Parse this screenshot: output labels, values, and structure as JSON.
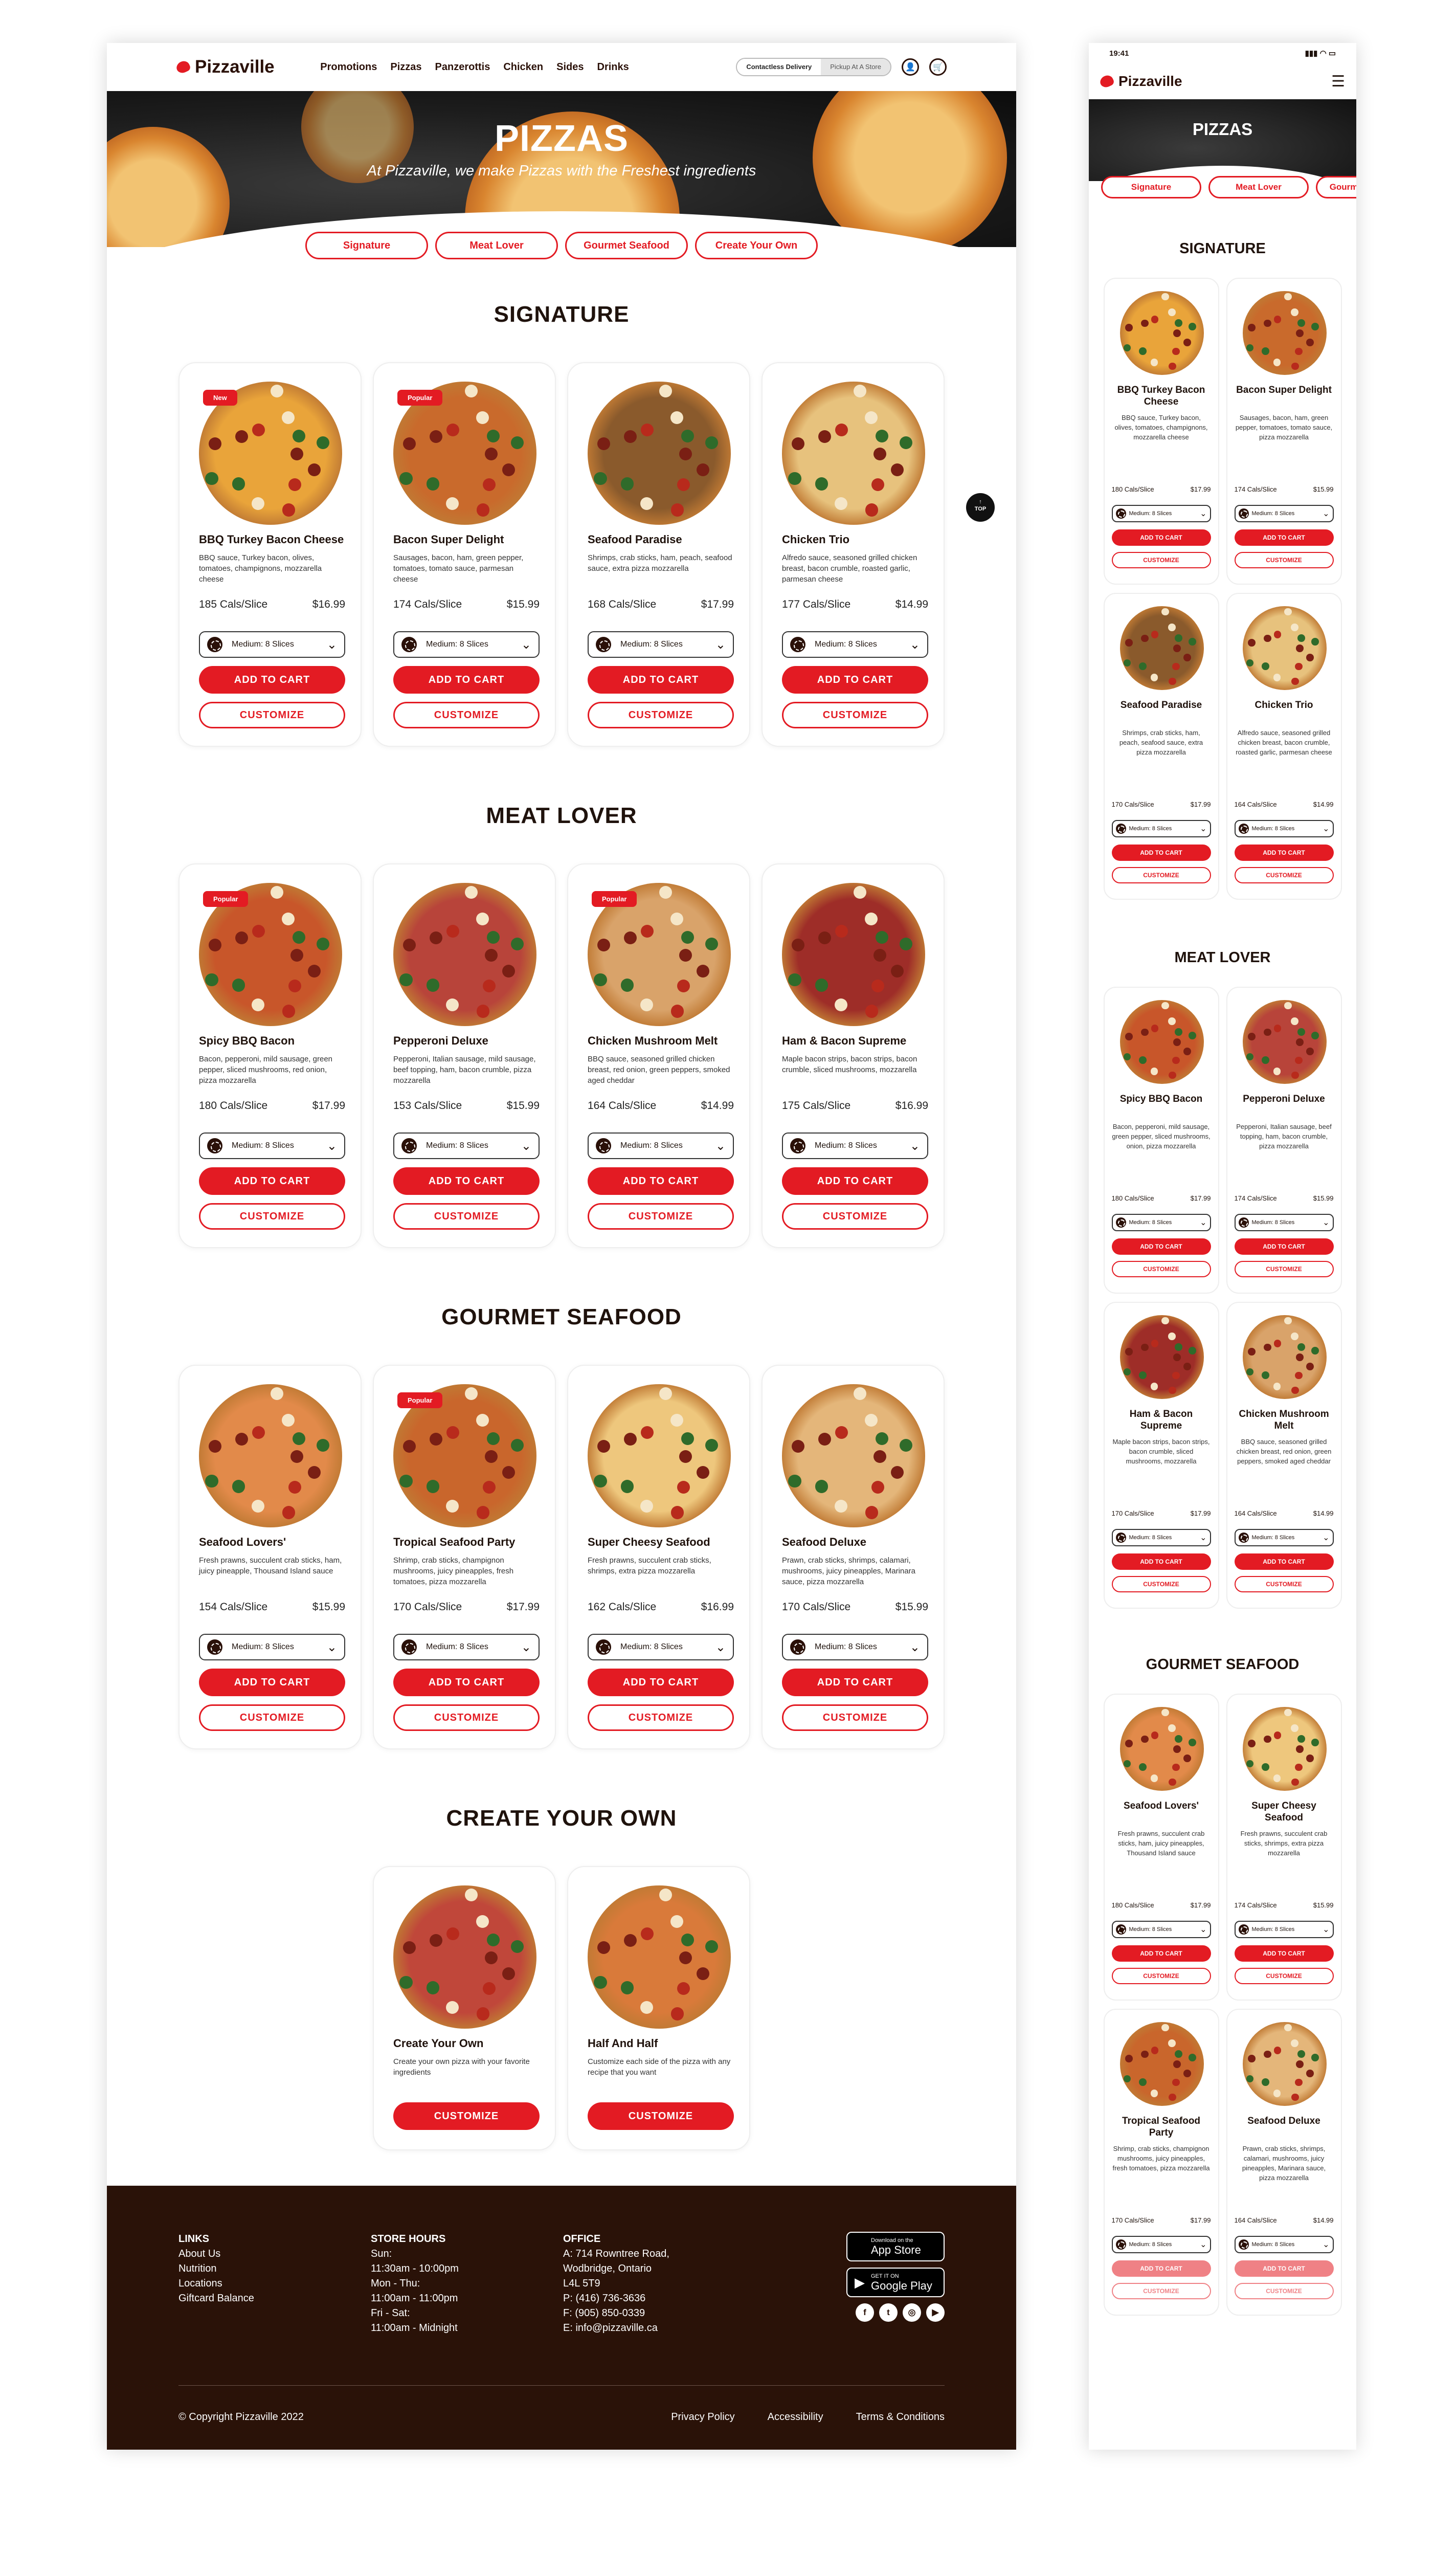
{
  "desktop": {
    "brand": "Pizzaville",
    "nav": [
      "Promotions",
      "Pizzas",
      "Panzerottis",
      "Chicken",
      "Sides",
      "Drinks"
    ],
    "toggle": {
      "active": "Contactless Delivery",
      "inactive": "Pickup At A Store"
    },
    "hero": {
      "title": "PIZZAS",
      "subtitle": "At Pizzaville, we make Pizzas with the Freshest ingredients"
    },
    "pills": [
      "Signature",
      "Meat Lover",
      "Gourmet Seafood",
      "Create Your Own"
    ],
    "top_label": "TOP",
    "sections": [
      {
        "title": "SIGNATURE",
        "items": [
          {
            "badge": "New",
            "name": "BBQ Turkey Bacon Cheese",
            "desc": "BBQ sauce, Turkey bacon, olives, tomatoes, champignons, mozzarella cheese",
            "cal": "185 Cals/Slice",
            "price": "$16.99",
            "size": "Medium: 8 Slices",
            "add": "ADD TO CART",
            "customize": "CUSTOMIZE",
            "color": "#e9a43a"
          },
          {
            "badge": "Popular",
            "name": "Bacon Super Delight",
            "desc": "Sausages, bacon, ham, green pepper, tomatoes, tomato sauce, parmesan cheese",
            "cal": "174 Cals/Slice",
            "price": "$15.99",
            "size": "Medium: 8 Slices",
            "add": "ADD TO CART",
            "customize": "CUSTOMIZE",
            "color": "#c96a2c"
          },
          {
            "badge": "",
            "name": "Seafood Paradise",
            "desc": "Shrimps, crab sticks, ham, peach, seafood sauce, extra pizza mozzarella",
            "cal": "168 Cals/Slice",
            "price": "$17.99",
            "size": "Medium: 8 Slices",
            "add": "ADD TO CART",
            "customize": "CUSTOMIZE",
            "color": "#8a5a2c"
          },
          {
            "badge": "",
            "name": "Chicken Trio",
            "desc": "Alfredo sauce, seasoned grilled chicken breast, bacon crumble, roasted garlic, parmesan cheese",
            "cal": "177 Cals/Slice",
            "price": "$14.99",
            "size": "Medium: 8 Slices",
            "add": "ADD TO CART",
            "customize": "CUSTOMIZE",
            "color": "#e7c27d"
          }
        ]
      },
      {
        "title": "MEAT LOVER",
        "items": [
          {
            "badge": "Popular",
            "name": "Spicy BBQ Bacon",
            "desc": "Bacon, pepperoni, mild sausage, green pepper, sliced mushrooms, red onion, pizza mozzarella",
            "cal": "180 Cals/Slice",
            "price": "$17.99",
            "size": "Medium: 8 Slices",
            "add": "ADD TO CART",
            "customize": "CUSTOMIZE",
            "color": "#c8562a"
          },
          {
            "badge": "",
            "name": "Pepperoni Deluxe",
            "desc": "Pepperoni, Italian sausage, mild sausage, beef topping, ham, bacon crumble, pizza mozzarella",
            "cal": "153 Cals/Slice",
            "price": "$15.99",
            "size": "Medium: 8 Slices",
            "add": "ADD TO CART",
            "customize": "CUSTOMIZE",
            "color": "#b8443a"
          },
          {
            "badge": "Popular",
            "name": "Chicken Mushroom Melt",
            "desc": "BBQ sauce, seasoned grilled chicken breast, red onion, green peppers, smoked aged cheddar",
            "cal": "164 Cals/Slice",
            "price": "$14.99",
            "size": "Medium: 8 Slices",
            "add": "ADD TO CART",
            "customize": "CUSTOMIZE",
            "color": "#d9a36a"
          },
          {
            "badge": "",
            "name": "Ham & Bacon Supreme",
            "desc": "Maple bacon strips, bacon strips, bacon crumble, sliced mushrooms, mozzarella",
            "cal": "175 Cals/Slice",
            "price": "$16.99",
            "size": "Medium: 8 Slices",
            "add": "ADD TO CART",
            "customize": "CUSTOMIZE",
            "color": "#9e2d28"
          }
        ]
      },
      {
        "title": "GOURMET SEAFOOD",
        "items": [
          {
            "badge": "",
            "name": "Seafood Lovers'",
            "desc": "Fresh prawns, succulent crab sticks, ham, juicy pineapple, Thousand Island sauce",
            "cal": "154 Cals/Slice",
            "price": "$15.99",
            "size": "Medium: 8 Slices",
            "add": "ADD TO CART",
            "customize": "CUSTOMIZE",
            "color": "#e28a4a"
          },
          {
            "badge": "Popular",
            "name": "Tropical Seafood Party",
            "desc": "Shrimp, crab sticks, champignon mushrooms, juicy pineapples, fresh tomatoes, pizza mozzarella",
            "cal": "170 Cals/Slice",
            "price": "$17.99",
            "size": "Medium: 8 Slices",
            "add": "ADD TO CART",
            "customize": "CUSTOMIZE",
            "color": "#c9662c"
          },
          {
            "badge": "",
            "name": "Super Cheesy Seafood",
            "desc": "Fresh prawns, succulent crab sticks, shrimps, extra pizza mozzarella",
            "cal": "162 Cals/Slice",
            "price": "$16.99",
            "size": "Medium: 8 Slices",
            "add": "ADD TO CART",
            "customize": "CUSTOMIZE",
            "color": "#eec77d"
          },
          {
            "badge": "",
            "name": "Seafood Deluxe",
            "desc": "Prawn, crab sticks, shrimps, calamari, mushrooms, juicy pineapples, Marinara sauce, pizza mozzarella",
            "cal": "170 Cals/Slice",
            "price": "$15.99",
            "size": "Medium: 8 Slices",
            "add": "ADD TO CART",
            "customize": "CUSTOMIZE",
            "color": "#e4b67a"
          }
        ]
      }
    ],
    "create": {
      "title": "CREATE YOUR OWN",
      "items": [
        {
          "name": "Create Your Own",
          "desc": "Create your own pizza with your favorite ingredients",
          "customize": "CUSTOMIZE",
          "color": "#c0473a"
        },
        {
          "name": "Half And Half",
          "desc": "Customize each side of the pizza with any recipe that you want",
          "customize": "CUSTOMIZE",
          "color": "#d97a3a"
        }
      ]
    },
    "footer": {
      "links": {
        "title": "LINKS",
        "items": [
          "About Us",
          "Nutrition",
          "Locations",
          "Giftcard Balance"
        ]
      },
      "hours": {
        "title": "STORE HOURS",
        "items": [
          "Sun:",
          "11:30am - 10:00pm",
          "Mon - Thu:",
          "11:00am - 11:00pm",
          "Fri - Sat:",
          "11:00am - Midnight"
        ]
      },
      "office": {
        "title": "OFFICE",
        "items": [
          "A: 714 Rowntree Road,",
          "Wodbridge, Ontario",
          "L4L 5T9",
          "P: (416) 736-3636",
          "F: (905) 850-0339",
          "E: info@pizzaville.ca"
        ]
      },
      "apps": [
        {
          "small": "Download on the",
          "big": "App Store"
        },
        {
          "small": "GET IT ON",
          "big": "Google Play"
        }
      ],
      "copyright": "© Copyright Pizzaville 2022",
      "bottom_links": [
        "Privacy Policy",
        "Accessibility",
        "Terms & Conditions"
      ]
    }
  },
  "mobile": {
    "time": "19:41",
    "brand": "Pizzaville",
    "hero_title": "PIZZAS",
    "pills": [
      "Signature",
      "Meat Lover",
      "Gourmet Seafood"
    ],
    "sections": [
      {
        "title": "SIGNATURE",
        "items": [
          {
            "name": "BBQ Turkey Bacon Cheese",
            "desc": "BBQ sauce, Turkey bacon, olives, tomatoes, champignons, mozzarella cheese",
            "cal": "180 Cals/Slice",
            "price": "$17.99",
            "size": "Medium: 8 Slices",
            "add": "ADD TO CART",
            "customize": "CUSTOMIZE",
            "color": "#e9a43a"
          },
          {
            "name": "Bacon Super Delight",
            "desc": "Sausages, bacon, ham, green pepper, tomatoes, tomato sauce, pizza mozzarella",
            "cal": "174 Cals/Slice",
            "price": "$15.99",
            "size": "Medium: 8 Slices",
            "add": "ADD TO CART",
            "customize": "CUSTOMIZE",
            "color": "#c96a2c"
          },
          {
            "name": "Seafood Paradise",
            "desc": "Shrimps, crab sticks, ham, peach, seafood sauce, extra pizza mozzarella",
            "cal": "170 Cals/Slice",
            "price": "$17.99",
            "size": "Medium: 8 Slices",
            "add": "ADD TO CART",
            "customize": "CUSTOMIZE",
            "color": "#8a5a2c"
          },
          {
            "name": "Chicken Trio",
            "desc": "Alfredo sauce, seasoned grilled chicken breast, bacon crumble, roasted garlic, parmesan cheese",
            "cal": "164 Cals/Slice",
            "price": "$14.99",
            "size": "Medium: 8 Slices",
            "add": "ADD TO CART",
            "customize": "CUSTOMIZE",
            "color": "#e7c27d"
          }
        ]
      },
      {
        "title": "MEAT LOVER",
        "items": [
          {
            "name": "Spicy BBQ Bacon",
            "desc": "Bacon, pepperoni, mild sausage, green pepper, sliced mushrooms, onion, pizza mozzarella",
            "cal": "180 Cals/Slice",
            "price": "$17.99",
            "size": "Medium: 8 Slices",
            "add": "ADD TO CART",
            "customize": "CUSTOMIZE",
            "color": "#c8562a"
          },
          {
            "name": "Pepperoni Deluxe",
            "desc": "Pepperoni, Italian sausage, beef topping, ham, bacon crumble, pizza mozzarella",
            "cal": "174 Cals/Slice",
            "price": "$15.99",
            "size": "Medium: 8 Slices",
            "add": "ADD TO CART",
            "customize": "CUSTOMIZE",
            "color": "#b8443a"
          },
          {
            "name": "Ham & Bacon Supreme",
            "desc": "Maple bacon strips, bacon strips, bacon crumble, sliced mushrooms, mozzarella",
            "cal": "170 Cals/Slice",
            "price": "$17.99",
            "size": "Medium: 8 Slices",
            "add": "ADD TO CART",
            "customize": "CUSTOMIZE",
            "color": "#9e2d28"
          },
          {
            "name": "Chicken Mushroom Melt",
            "desc": "BBQ sauce, seasoned grilled chicken breast, red onion, green peppers, smoked aged cheddar",
            "cal": "164 Cals/Slice",
            "price": "$14.99",
            "size": "Medium: 8 Slices",
            "add": "ADD TO CART",
            "customize": "CUSTOMIZE",
            "color": "#d9a36a"
          }
        ]
      },
      {
        "title": "GOURMET SEAFOOD",
        "items": [
          {
            "name": "Seafood Lovers'",
            "desc": "Fresh prawns, succulent crab sticks, ham, juicy pineapples, Thousand Island sauce",
            "cal": "180 Cals/Slice",
            "price": "$17.99",
            "size": "Medium: 8 Slices",
            "add": "ADD TO CART",
            "customize": "CUSTOMIZE",
            "color": "#e28a4a"
          },
          {
            "name": "Super Cheesy Seafood",
            "desc": "Fresh prawns, succulent crab sticks, shrimps, extra pizza mozzarella",
            "cal": "174 Cals/Slice",
            "price": "$15.99",
            "size": "Medium: 8 Slices",
            "add": "ADD TO CART",
            "customize": "CUSTOMIZE",
            "color": "#eec77d"
          },
          {
            "name": "Tropical Seafood Party",
            "desc": "Shrimp, crab sticks, champignon mushrooms, juicy pineapples, fresh tomatoes, pizza mozzarella",
            "cal": "170 Cals/Slice",
            "price": "$17.99",
            "size": "Medium: 8 Slices",
            "add": "ADD TO CART",
            "customize": "CUSTOMIZE",
            "color": "#c9662c"
          },
          {
            "name": "Seafood Deluxe",
            "desc": "Prawn, crab sticks, shrimps, calamari, mushrooms, juicy pineapples, Marinara sauce, pizza mozzarella",
            "cal": "164 Cals/Slice",
            "price": "$14.99",
            "size": "Medium: 8 Slices",
            "add": "ADD TO CART",
            "customize": "CUSTOMIZE",
            "color": "#e4b67a"
          }
        ]
      }
    ]
  }
}
